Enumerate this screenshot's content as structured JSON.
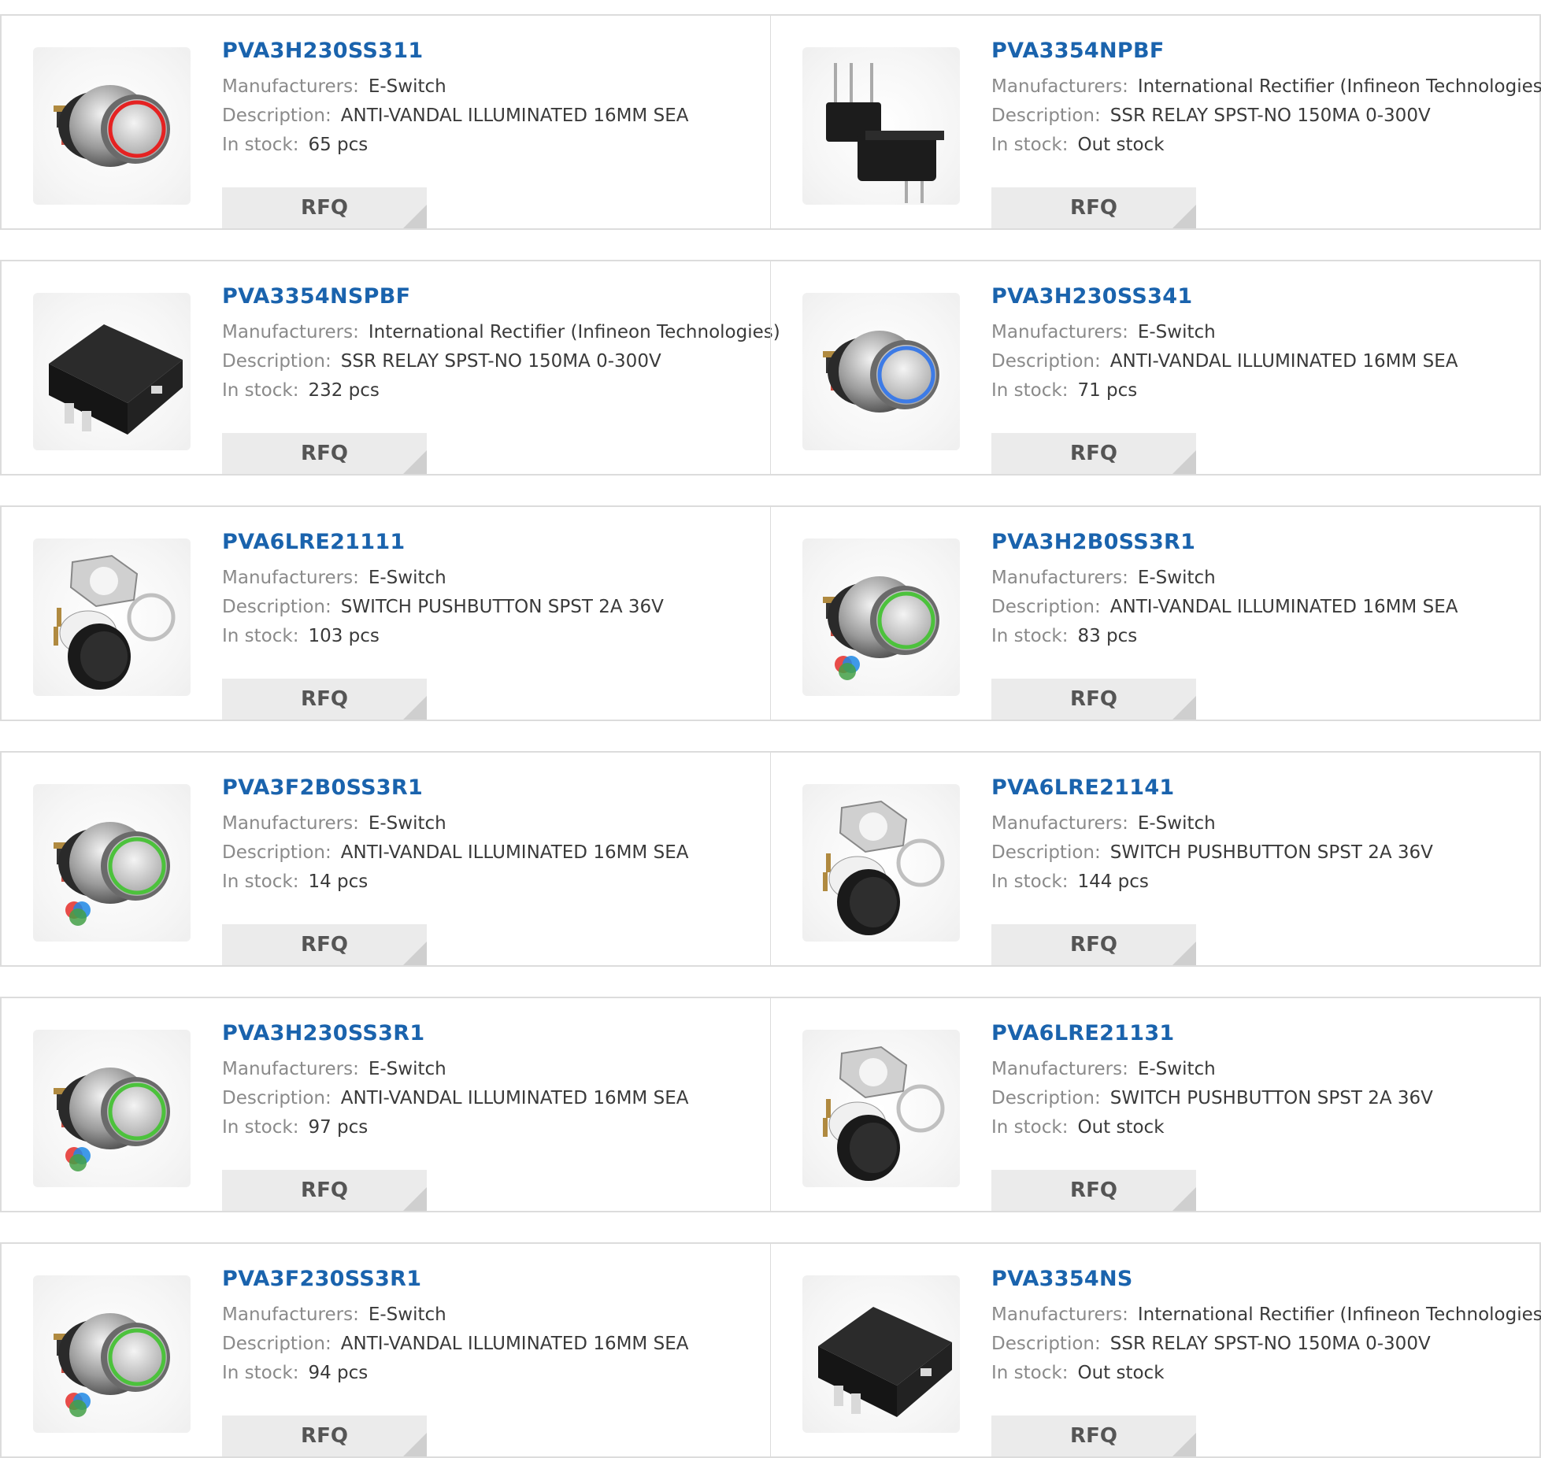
{
  "labels": {
    "manufacturers": "Manufacturers:",
    "description": "Description:",
    "in_stock": "In stock:",
    "rfq": "RFQ"
  },
  "colors": {
    "part_number": "#1a63ad",
    "border": "#dcdcdc",
    "rfq_bg": "#ebebeb"
  },
  "products": [
    {
      "part": "PVA3H230SS311",
      "manufacturer": "E-Switch",
      "description": "ANTI-VANDAL ILLUMINATED 16MM SEA",
      "stock": "65 pcs",
      "image": "pushbutton-red-ring-icon"
    },
    {
      "part": "PVA3354NPBF",
      "manufacturer": "International Rectifier (Infineon Technologies)",
      "description": "SSR RELAY SPST-NO 150MA 0-300V",
      "stock": "Out stock",
      "image": "dip-relay-icon"
    },
    {
      "part": "PVA3354NSPBF",
      "manufacturer": "International Rectifier (Infineon Technologies)",
      "description": "SSR RELAY SPST-NO 150MA 0-300V",
      "stock": "232 pcs",
      "image": "smd-relay-icon"
    },
    {
      "part": "PVA3H230SS341",
      "manufacturer": "E-Switch",
      "description": "ANTI-VANDAL ILLUMINATED 16MM SEA",
      "stock": "71 pcs",
      "image": "pushbutton-blue-ring-icon"
    },
    {
      "part": "PVA6LRE21111",
      "manufacturer": "E-Switch",
      "description": "SWITCH PUSHBUTTON SPST 2A 36V",
      "stock": "103 pcs",
      "image": "black-pushbutton-nut-icon"
    },
    {
      "part": "PVA3H2B0SS3R1",
      "manufacturer": "E-Switch",
      "description": "ANTI-VANDAL ILLUMINATED 16MM SEA",
      "stock": "83 pcs",
      "image": "pushbutton-rgb-ring-icon"
    },
    {
      "part": "PVA3F2B0SS3R1",
      "manufacturer": "E-Switch",
      "description": "ANTI-VANDAL ILLUMINATED 16MM SEA",
      "stock": "14 pcs",
      "image": "pushbutton-rgb-ring-icon"
    },
    {
      "part": "PVA6LRE21141",
      "manufacturer": "E-Switch",
      "description": "SWITCH PUSHBUTTON SPST 2A 36V",
      "stock": "144 pcs",
      "image": "black-pushbutton-nut-icon"
    },
    {
      "part": "PVA3H230SS3R1",
      "manufacturer": "E-Switch",
      "description": "ANTI-VANDAL ILLUMINATED 16MM SEA",
      "stock": "97 pcs",
      "image": "pushbutton-rgb-ring-icon"
    },
    {
      "part": "PVA6LRE21131",
      "manufacturer": "E-Switch",
      "description": "SWITCH PUSHBUTTON SPST 2A 36V",
      "stock": "Out stock",
      "image": "black-pushbutton-nut-icon"
    },
    {
      "part": "PVA3F230SS3R1",
      "manufacturer": "E-Switch",
      "description": "ANTI-VANDAL ILLUMINATED 16MM SEA",
      "stock": "94 pcs",
      "image": "pushbutton-rgb-ring-icon"
    },
    {
      "part": "PVA3354NS",
      "manufacturer": "International Rectifier (Infineon Technologies)",
      "description": "SSR RELAY SPST-NO 150MA 0-300V",
      "stock": "Out stock",
      "image": "smd-relay-icon"
    }
  ]
}
